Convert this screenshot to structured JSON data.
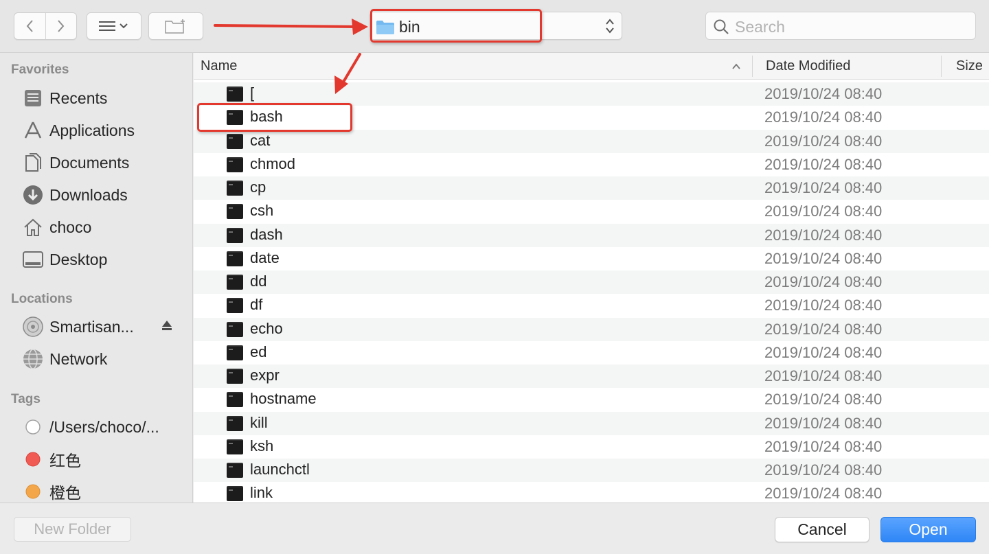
{
  "toolbar": {
    "back_icon": "chevron-left-icon",
    "forward_icon": "chevron-right-icon",
    "view_icon": "list-view-icon",
    "new_folder_icon": "new-folder-icon",
    "path": {
      "folder_icon": "folder-icon",
      "label": "bin"
    },
    "search": {
      "placeholder": "Search"
    }
  },
  "sidebar": {
    "favorites_heading": "Favorites",
    "favorites": [
      {
        "label": "Recents",
        "icon": "recents-icon"
      },
      {
        "label": "Applications",
        "icon": "applications-icon"
      },
      {
        "label": "Documents",
        "icon": "documents-icon"
      },
      {
        "label": "Downloads",
        "icon": "downloads-icon"
      },
      {
        "label": "choco",
        "icon": "home-icon"
      },
      {
        "label": "Desktop",
        "icon": "desktop-icon"
      }
    ],
    "locations_heading": "Locations",
    "locations": [
      {
        "label": "Smartisan...",
        "icon": "disk-icon"
      },
      {
        "label": "Network",
        "icon": "network-icon"
      }
    ],
    "tags_heading": "Tags",
    "tags": [
      {
        "label": "/Users/choco/...",
        "color": "#ffffff"
      },
      {
        "label": "红色",
        "color": "#f05c54"
      },
      {
        "label": "橙色",
        "color": "#f4a64a"
      }
    ]
  },
  "list": {
    "columns": {
      "name": "Name",
      "date": "Date Modified",
      "size": "Size"
    },
    "rows": [
      {
        "name": "[",
        "date": "2019/10/24 08:40"
      },
      {
        "name": "bash",
        "date": "2019/10/24 08:40"
      },
      {
        "name": "cat",
        "date": "2019/10/24 08:40"
      },
      {
        "name": "chmod",
        "date": "2019/10/24 08:40"
      },
      {
        "name": "cp",
        "date": "2019/10/24 08:40"
      },
      {
        "name": "csh",
        "date": "2019/10/24 08:40"
      },
      {
        "name": "dash",
        "date": "2019/10/24 08:40"
      },
      {
        "name": "date",
        "date": "2019/10/24 08:40"
      },
      {
        "name": "dd",
        "date": "2019/10/24 08:40"
      },
      {
        "name": "df",
        "date": "2019/10/24 08:40"
      },
      {
        "name": "echo",
        "date": "2019/10/24 08:40"
      },
      {
        "name": "ed",
        "date": "2019/10/24 08:40"
      },
      {
        "name": "expr",
        "date": "2019/10/24 08:40"
      },
      {
        "name": "hostname",
        "date": "2019/10/24 08:40"
      },
      {
        "name": "kill",
        "date": "2019/10/24 08:40"
      },
      {
        "name": "ksh",
        "date": "2019/10/24 08:40"
      },
      {
        "name": "launchctl",
        "date": "2019/10/24 08:40"
      },
      {
        "name": "link",
        "date": "2019/10/24 08:40"
      }
    ]
  },
  "buttons": {
    "new_folder": "New Folder",
    "cancel": "Cancel",
    "open": "Open"
  },
  "colors": {
    "annotation": "#e2382d",
    "accent": "#2f86f6"
  }
}
